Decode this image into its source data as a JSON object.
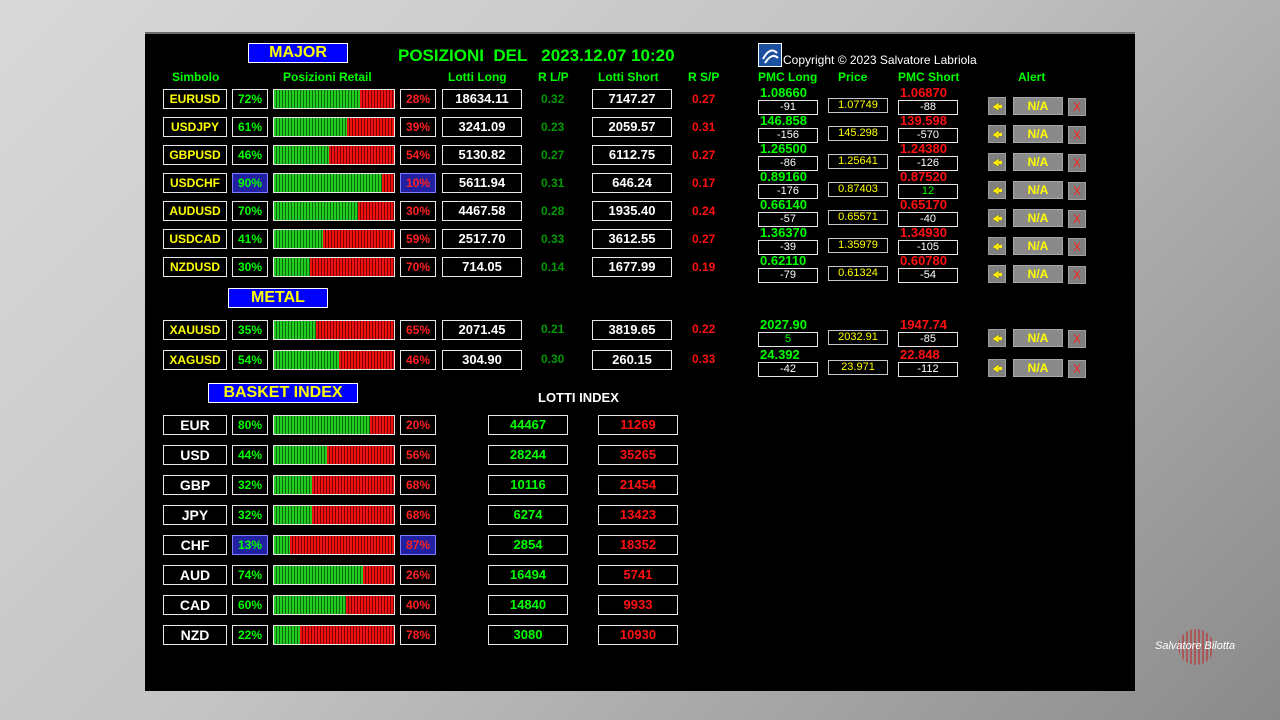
{
  "header": {
    "major_label": "MAJOR",
    "title": "POSIZIONI  DEL   2023.12.07 10:20",
    "copyright": "Copyright © 2023 Salvatore Labriola",
    "metal_label": "METAL",
    "basket_label": "BASKET INDEX",
    "lotti_index_label": "LOTTI INDEX"
  },
  "columns": {
    "simbolo": "Simbolo",
    "posizioni_retail": "Posizioni Retail",
    "lotti_long": "Lotti Long",
    "r_lp": "R L/P",
    "lotti_short": "Lotti Short",
    "r_sp": "R S/P",
    "pmc_long": "PMC Long",
    "price": "Price",
    "pmc_short": "PMC Short",
    "alert": "Alert"
  },
  "pairs": [
    {
      "symbol": "EURUSD",
      "long_pct": "72%",
      "long": 72,
      "short_pct": "28%",
      "lotti_long": "18634.11",
      "r_lp": "0.32",
      "lotti_short": "7147.27",
      "r_sp": "0.27",
      "pmc_long": "1.08660",
      "pmc_long_diff": "-91",
      "price": "1.07749",
      "pmc_short": "1.06870",
      "pmc_short_diff": "-88",
      "pmc_short_diff_positive": false,
      "alert": "N/A",
      "x": "X",
      "highlight": false
    },
    {
      "symbol": "USDJPY",
      "long_pct": "61%",
      "long": 61,
      "short_pct": "39%",
      "lotti_long": "3241.09",
      "r_lp": "0.23",
      "lotti_short": "2059.57",
      "r_sp": "0.31",
      "pmc_long": "146.858",
      "pmc_long_diff": "-156",
      "price": "145.298",
      "pmc_short": "139.598",
      "pmc_short_diff": "-570",
      "pmc_short_diff_positive": false,
      "alert": "N/A",
      "x": "X",
      "highlight": false
    },
    {
      "symbol": "GBPUSD",
      "long_pct": "46%",
      "long": 46,
      "short_pct": "54%",
      "lotti_long": "5130.82",
      "r_lp": "0.27",
      "lotti_short": "6112.75",
      "r_sp": "0.27",
      "pmc_long": "1.26500",
      "pmc_long_diff": "-86",
      "price": "1.25641",
      "pmc_short": "1.24380",
      "pmc_short_diff": "-126",
      "pmc_short_diff_positive": false,
      "alert": "N/A",
      "x": "X",
      "highlight": false
    },
    {
      "symbol": "USDCHF",
      "long_pct": "90%",
      "long": 90,
      "short_pct": "10%",
      "lotti_long": "5611.94",
      "r_lp": "0.31",
      "lotti_short": "646.24",
      "r_sp": "0.17",
      "pmc_long": "0.89160",
      "pmc_long_diff": "-176",
      "price": "0.87403",
      "pmc_short": "0.87520",
      "pmc_short_diff": "12",
      "pmc_short_diff_positive": true,
      "alert": "N/A",
      "x": "X",
      "highlight": true
    },
    {
      "symbol": "AUDUSD",
      "long_pct": "70%",
      "long": 70,
      "short_pct": "30%",
      "lotti_long": "4467.58",
      "r_lp": "0.28",
      "lotti_short": "1935.40",
      "r_sp": "0.24",
      "pmc_long": "0.66140",
      "pmc_long_diff": "-57",
      "price": "0.65571",
      "pmc_short": "0.65170",
      "pmc_short_diff": "-40",
      "pmc_short_diff_positive": false,
      "alert": "N/A",
      "x": "X",
      "highlight": false
    },
    {
      "symbol": "USDCAD",
      "long_pct": "41%",
      "long": 41,
      "short_pct": "59%",
      "lotti_long": "2517.70",
      "r_lp": "0.33",
      "lotti_short": "3612.55",
      "r_sp": "0.27",
      "pmc_long": "1.36370",
      "pmc_long_diff": "-39",
      "price": "1.35979",
      "pmc_short": "1.34930",
      "pmc_short_diff": "-105",
      "pmc_short_diff_positive": false,
      "alert": "N/A",
      "x": "X",
      "highlight": false
    },
    {
      "symbol": "NZDUSD",
      "long_pct": "30%",
      "long": 30,
      "short_pct": "70%",
      "lotti_long": "714.05",
      "r_lp": "0.14",
      "lotti_short": "1677.99",
      "r_sp": "0.19",
      "pmc_long": "0.62110",
      "pmc_long_diff": "-79",
      "price": "0.61324",
      "pmc_short": "0.60780",
      "pmc_short_diff": "-54",
      "pmc_short_diff_positive": false,
      "alert": "N/A",
      "x": "X",
      "highlight": false
    }
  ],
  "metals": [
    {
      "symbol": "XAUUSD",
      "long_pct": "35%",
      "long": 35,
      "short_pct": "65%",
      "lotti_long": "2071.45",
      "r_lp": "0.21",
      "lotti_short": "3819.65",
      "r_sp": "0.22",
      "pmc_long": "2027.90",
      "pmc_long_diff": "5",
      "pmc_long_diff_positive": true,
      "price": "2032.91",
      "pmc_short": "1947.74",
      "pmc_short_diff": "-85",
      "alert": "N/A",
      "x": "X"
    },
    {
      "symbol": "XAGUSD",
      "long_pct": "54%",
      "long": 54,
      "short_pct": "46%",
      "lotti_long": "304.90",
      "r_lp": "0.30",
      "lotti_short": "260.15",
      "r_sp": "0.33",
      "pmc_long": "24.392",
      "pmc_long_diff": "-42",
      "pmc_long_diff_positive": false,
      "price": "23.971",
      "pmc_short": "22.848",
      "pmc_short_diff": "-112",
      "alert": "N/A",
      "x": "X"
    }
  ],
  "basket": [
    {
      "currency": "EUR",
      "long_pct": "80%",
      "long": 80,
      "short_pct": "20%",
      "lotti_long": "44467",
      "lotti_short": "11269",
      "highlight": false
    },
    {
      "currency": "USD",
      "long_pct": "44%",
      "long": 44,
      "short_pct": "56%",
      "lotti_long": "28244",
      "lotti_short": "35265",
      "highlight": false
    },
    {
      "currency": "GBP",
      "long_pct": "32%",
      "long": 32,
      "short_pct": "68%",
      "lotti_long": "10116",
      "lotti_short": "21454",
      "highlight": false
    },
    {
      "currency": "JPY",
      "long_pct": "32%",
      "long": 32,
      "short_pct": "68%",
      "lotti_long": "6274",
      "lotti_short": "13423",
      "highlight": false
    },
    {
      "currency": "CHF",
      "long_pct": "13%",
      "long": 13,
      "short_pct": "87%",
      "lotti_long": "2854",
      "lotti_short": "18352",
      "highlight": true
    },
    {
      "currency": "AUD",
      "long_pct": "74%",
      "long": 74,
      "short_pct": "26%",
      "lotti_long": "16494",
      "lotti_short": "5741",
      "highlight": false
    },
    {
      "currency": "CAD",
      "long_pct": "60%",
      "long": 60,
      "short_pct": "40%",
      "lotti_long": "14840",
      "lotti_short": "9933",
      "highlight": false
    },
    {
      "currency": "NZD",
      "long_pct": "22%",
      "long": 22,
      "short_pct": "78%",
      "lotti_long": "3080",
      "lotti_short": "10930",
      "highlight": false
    }
  ],
  "watermark": {
    "name": "Salvatore Bilotta"
  },
  "colors": {
    "long": "#00ff00",
    "short": "#ff1010",
    "header_bg": "#0000ff",
    "header_text": "#ffff00"
  }
}
